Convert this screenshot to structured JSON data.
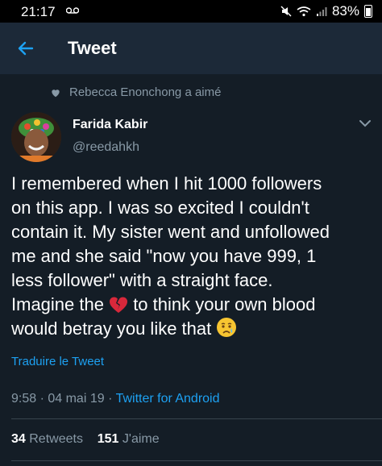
{
  "status_bar": {
    "time": "21:17",
    "battery": "83%"
  },
  "app_bar": {
    "title": "Tweet"
  },
  "social_context": {
    "text": "Rebecca Enonchong a aimé"
  },
  "author": {
    "name": "Farida Kabir",
    "handle": "@reedahkh"
  },
  "tweet": {
    "line1": "I remembered when I hit 1000 followers",
    "line2": "on this app. I was so excited I couldn't",
    "line3": "contain it. My sister went and unfollowed",
    "line4": "me and she said \"now you have 999, 1",
    "line5": "less follower\" with a straight face.",
    "line6a": "Imagine the ",
    "line6b": " to think your own blood",
    "line7": "would betray you like that ",
    "broken_heart_icon": "broken-heart-emoji",
    "crying_face_icon": "crying-face-emoji"
  },
  "translate_link": "Traduire le Tweet",
  "meta": {
    "time": "9:58",
    "separator1": " · ",
    "date": "04 mai 19",
    "separator2": " · ",
    "client": "Twitter for Android"
  },
  "stats": {
    "retweets_count": "34",
    "retweets_label": "Retweets",
    "likes_count": "151",
    "likes_label": "J'aime"
  },
  "colors": {
    "background": "#141d26",
    "appbar": "#1c2938",
    "accent": "#1da1f2",
    "muted": "#8899a6"
  }
}
